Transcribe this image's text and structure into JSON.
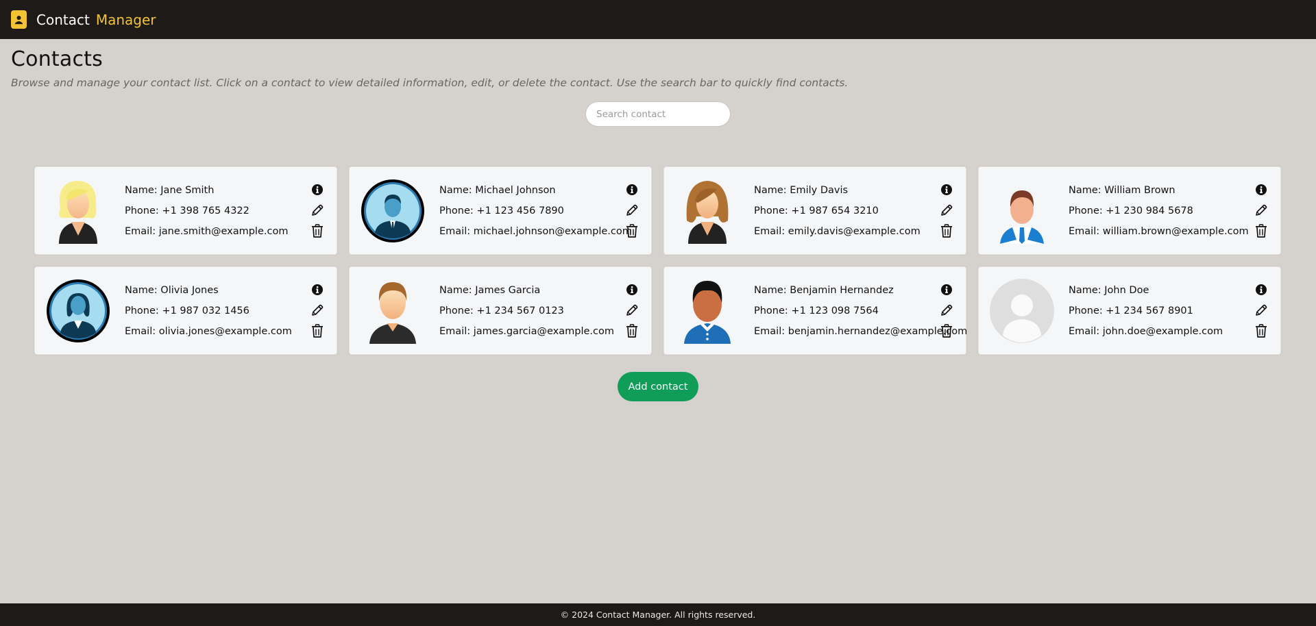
{
  "app": {
    "brand_part1": "Contact",
    "brand_part2": "Manager",
    "brand_icon": "contact-book-icon",
    "accent_color": "#f2c335"
  },
  "page": {
    "title": "Contacts",
    "description": "Browse and manage your contact list. Click on a contact to view detailed information, edit, or delete the contact. Use the search bar to quickly find contacts."
  },
  "search": {
    "placeholder": "Search contact",
    "value": ""
  },
  "labels": {
    "name": "Name:",
    "phone": "Phone:",
    "email": "Email:"
  },
  "contacts": [
    {
      "name": "Jane Smith",
      "phone": "+1 398 765 4322",
      "email": "jane.smith@example.com",
      "avatar": "woman-blonde"
    },
    {
      "name": "Michael Johnson",
      "phone": "+1 123 456 7890",
      "email": "michael.johnson@example.com",
      "avatar": "man-circle-blue"
    },
    {
      "name": "Emily Davis",
      "phone": "+1 987 654 3210",
      "email": "emily.davis@example.com",
      "avatar": "woman-brunette"
    },
    {
      "name": "William Brown",
      "phone": "+1 230 984 5678",
      "email": "william.brown@example.com",
      "avatar": "man-blue-shirt"
    },
    {
      "name": "Olivia Jones",
      "phone": "+1 987 032 1456",
      "email": "olivia.jones@example.com",
      "avatar": "woman-circle-blue"
    },
    {
      "name": "James Garcia",
      "phone": "+1 234 567 0123",
      "email": "james.garcia@example.com",
      "avatar": "man-brown-hair"
    },
    {
      "name": "Benjamin Hernandez",
      "phone": "+1 123 098 7564",
      "email": "benjamin.hernandez@example.com",
      "avatar": "man-dark-skin"
    },
    {
      "name": "John Doe",
      "phone": "+1 234 567 8901",
      "email": "john.doe@example.com",
      "avatar": "default-placeholder"
    }
  ],
  "actions": {
    "info_icon": "info-icon",
    "edit_icon": "pencil-icon",
    "delete_icon": "trash-icon"
  },
  "add_button": {
    "label": "Add contact",
    "color": "#0f9d58"
  },
  "footer": {
    "text": "© 2024 Contact Manager. All rights reserved."
  }
}
